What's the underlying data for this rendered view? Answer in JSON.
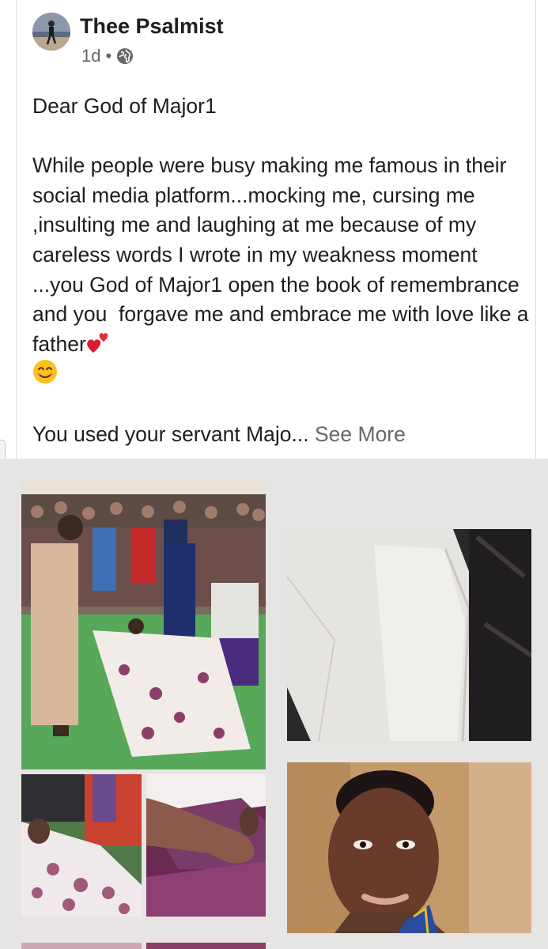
{
  "post": {
    "author": "Thee Psalmist",
    "time": "1d",
    "separator": "•",
    "privacy_icon": "globe-icon",
    "greeting": "Dear God of Major1",
    "body": "While people were busy making me famous in their social media platform...mocking me, cursing me ,insulting me and laughing at me because of my careless words I wrote in my weakness moment  ...you God of Major1 open the book of remembrance and you  forgave me and embrace me with love like a father",
    "emojis": [
      "two-hearts-icon",
      "smiling-face-icon"
    ],
    "preview": "You used your servant Majo... ",
    "see_more": "See More"
  },
  "gallery": {
    "photos": [
      {
        "name": "photo-church-prayer"
      },
      {
        "name": "photo-towel"
      },
      {
        "name": "photo-patient-bed"
      },
      {
        "name": "photo-hand-closeup"
      },
      {
        "name": "photo-woman-selfie"
      }
    ]
  },
  "colors": {
    "text": "#1c1e21",
    "secondary_text": "#65676b",
    "gallery_bg": "#e7e4e4"
  }
}
